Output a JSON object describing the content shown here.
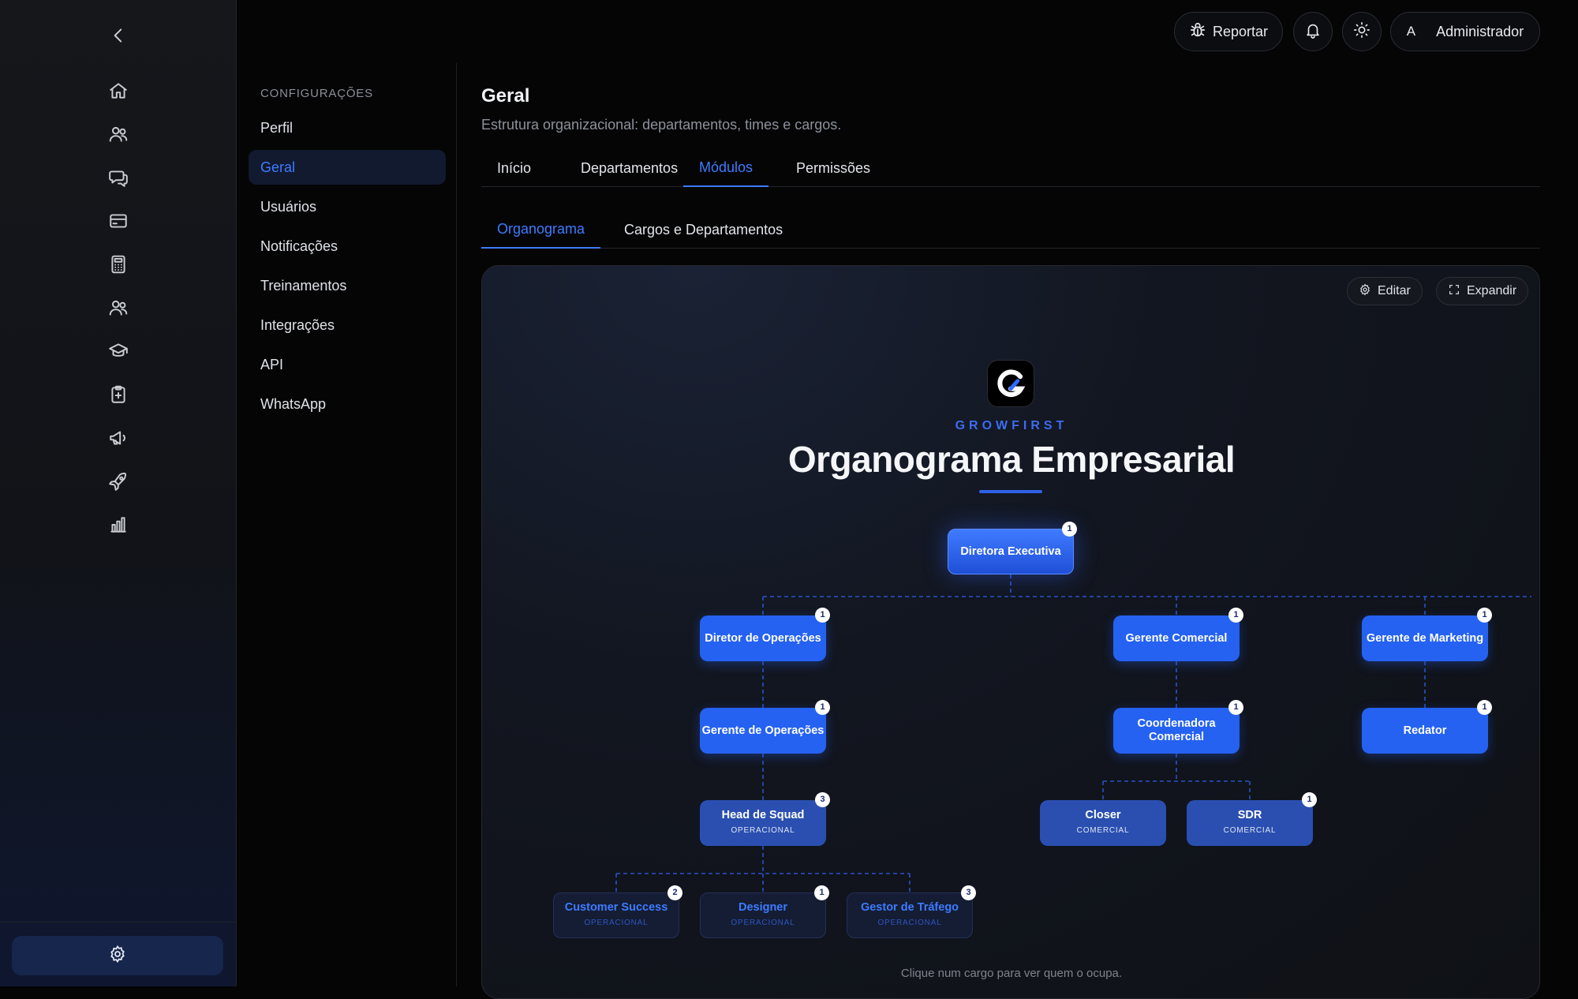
{
  "topbar": {
    "report_label": "Reportar",
    "avatar_letter": "A",
    "user_name": "Administrador"
  },
  "rail": {
    "icons": [
      "chevron-left-icon",
      "home-icon",
      "users-icon",
      "chat-icon",
      "card-icon",
      "calculator-icon",
      "team-icon",
      "graduation-cap-icon",
      "clipboard-icon",
      "megaphone-icon",
      "rocket-icon",
      "bar-chart-icon",
      "gear-icon"
    ]
  },
  "sidebar": {
    "header": "CONFIGURAÇÕES",
    "items": [
      {
        "label": "Perfil"
      },
      {
        "label": "Geral"
      },
      {
        "label": "Usuários"
      },
      {
        "label": "Notificações"
      },
      {
        "label": "Treinamentos"
      },
      {
        "label": "Integrações"
      },
      {
        "label": "API"
      },
      {
        "label": "WhatsApp"
      }
    ],
    "active_index": 1
  },
  "page": {
    "title": "Geral",
    "subtitle": "Estrutura organizacional: departamentos, times e cargos.",
    "tabs": [
      {
        "label": "Início"
      },
      {
        "label": "Departamentos"
      },
      {
        "label": "Módulos"
      },
      {
        "label": "Permissões"
      }
    ],
    "active_tab": 2,
    "subtabs": [
      {
        "label": "Organograma"
      },
      {
        "label": "Cargos e Departamentos"
      }
    ],
    "active_subtab": 0
  },
  "orgchart": {
    "edit_label": "Editar",
    "expand_label": "Expandir",
    "brand": "GROWFIRST",
    "title": "Organograma Empresarial",
    "hint": "Clique num cargo para ver quem o ocupa.",
    "accent": "#2562f2",
    "nodes": {
      "ceo": {
        "name": "Diretora Executiva",
        "count": "1"
      },
      "dir_ops": {
        "name": "Diretor de Operações",
        "count": "1"
      },
      "ger_com": {
        "name": "Gerente Comercial",
        "count": "1"
      },
      "ger_mkt": {
        "name": "Gerente de Marketing",
        "count": "1"
      },
      "ger_ops": {
        "name": "Gerente de Operações",
        "count": "1"
      },
      "coord_com": {
        "name": "Coordenadora Comercial",
        "count": "1"
      },
      "redator": {
        "name": "Redator",
        "count": "1"
      },
      "head_squad": {
        "name": "Head de Squad",
        "dept": "OPERACIONAL",
        "count": "3"
      },
      "closer": {
        "name": "Closer",
        "dept": "COMERCIAL",
        "count": ""
      },
      "sdr": {
        "name": "SDR",
        "dept": "COMERCIAL",
        "count": "1"
      },
      "cs": {
        "name": "Customer Success",
        "dept": "OPERACIONAL",
        "count": "2"
      },
      "designer": {
        "name": "Designer",
        "dept": "OPERACIONAL",
        "count": "1"
      },
      "gestor": {
        "name": "Gestor de Tráfego",
        "dept": "OPERACIONAL",
        "count": "3"
      }
    }
  }
}
